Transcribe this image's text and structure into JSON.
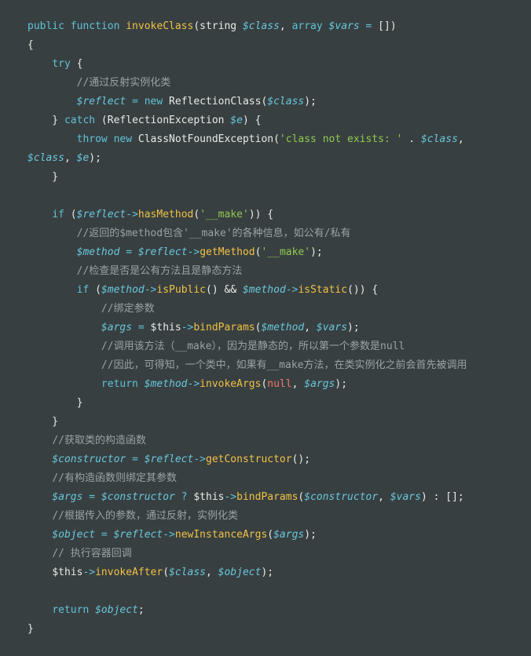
{
  "code": {
    "lines": [
      [
        [
          "kw",
          "public function "
        ],
        [
          "fn",
          "invokeClass"
        ],
        [
          "pl",
          "(string "
        ],
        [
          "var",
          "$class"
        ],
        [
          "pl",
          ", "
        ],
        [
          "kw",
          "array "
        ],
        [
          "var",
          "$vars"
        ],
        [
          "op",
          " = "
        ],
        [
          "pl",
          "[])"
        ]
      ],
      [
        [
          "pl",
          "{"
        ]
      ],
      [
        [
          "pl",
          "    "
        ],
        [
          "kw",
          "try"
        ],
        [
          "pl",
          " {"
        ]
      ],
      [
        [
          "pl",
          "        "
        ],
        [
          "cm",
          "//通过反射实例化类"
        ]
      ],
      [
        [
          "pl",
          "        "
        ],
        [
          "var",
          "$reflect"
        ],
        [
          "op",
          " = "
        ],
        [
          "kw",
          "new "
        ],
        [
          "pl",
          "ReflectionClass("
        ],
        [
          "var",
          "$class"
        ],
        [
          "pl",
          ");"
        ]
      ],
      [
        [
          "pl",
          "    } "
        ],
        [
          "kw",
          "catch"
        ],
        [
          "pl",
          " (ReflectionException "
        ],
        [
          "var",
          "$e"
        ],
        [
          "pl",
          ") {"
        ]
      ],
      [
        [
          "pl",
          "        "
        ],
        [
          "kw",
          "throw new "
        ],
        [
          "pl",
          "ClassNotFoundException("
        ],
        [
          "str",
          "'class not exists: '"
        ],
        [
          "pl",
          " . "
        ],
        [
          "var",
          "$class"
        ],
        [
          "pl",
          ","
        ]
      ],
      [
        [
          "var",
          "$class"
        ],
        [
          "pl",
          ", "
        ],
        [
          "var",
          "$e"
        ],
        [
          "pl",
          ");"
        ]
      ],
      [
        [
          "pl",
          "    }"
        ]
      ],
      [],
      [
        [
          "pl",
          "    "
        ],
        [
          "kw",
          "if"
        ],
        [
          "pl",
          " ("
        ],
        [
          "var",
          "$reflect"
        ],
        [
          "op",
          "->"
        ],
        [
          "fn",
          "hasMethod"
        ],
        [
          "pl",
          "("
        ],
        [
          "str",
          "'__make'"
        ],
        [
          "pl",
          ")) {"
        ]
      ],
      [
        [
          "pl",
          "        "
        ],
        [
          "cm",
          "//返回的$method包含'__make'的各种信息，如公有/私有"
        ]
      ],
      [
        [
          "pl",
          "        "
        ],
        [
          "var",
          "$method"
        ],
        [
          "op",
          " = "
        ],
        [
          "var",
          "$reflect"
        ],
        [
          "op",
          "->"
        ],
        [
          "fn",
          "getMethod"
        ],
        [
          "pl",
          "("
        ],
        [
          "str",
          "'__make'"
        ],
        [
          "pl",
          ");"
        ]
      ],
      [
        [
          "pl",
          "        "
        ],
        [
          "cm",
          "//检查是否是公有方法且是静态方法"
        ]
      ],
      [
        [
          "pl",
          "        "
        ],
        [
          "kw",
          "if"
        ],
        [
          "pl",
          " ("
        ],
        [
          "var",
          "$method"
        ],
        [
          "op",
          "->"
        ],
        [
          "fn",
          "isPublic"
        ],
        [
          "pl",
          "() && "
        ],
        [
          "var",
          "$method"
        ],
        [
          "op",
          "->"
        ],
        [
          "fn",
          "isStatic"
        ],
        [
          "pl",
          "()) {"
        ]
      ],
      [
        [
          "pl",
          "            "
        ],
        [
          "cm",
          "//绑定参数"
        ]
      ],
      [
        [
          "pl",
          "            "
        ],
        [
          "var",
          "$args"
        ],
        [
          "op",
          " = "
        ],
        [
          "this",
          "$this"
        ],
        [
          "op",
          "->"
        ],
        [
          "fn",
          "bindParams"
        ],
        [
          "pl",
          "("
        ],
        [
          "var",
          "$method"
        ],
        [
          "pl",
          ", "
        ],
        [
          "var",
          "$vars"
        ],
        [
          "pl",
          ");"
        ]
      ],
      [
        [
          "pl",
          "            "
        ],
        [
          "cm",
          "//调用该方法（__make），因为是静态的，所以第一个参数是null"
        ]
      ],
      [
        [
          "pl",
          "            "
        ],
        [
          "cm",
          "//因此，可得知，一个类中，如果有__make方法，在类实例化之前会首先被调用"
        ]
      ],
      [
        [
          "pl",
          "            "
        ],
        [
          "kw",
          "return "
        ],
        [
          "var",
          "$method"
        ],
        [
          "op",
          "->"
        ],
        [
          "fn",
          "invokeArgs"
        ],
        [
          "pl",
          "("
        ],
        [
          "null",
          "null"
        ],
        [
          "pl",
          ", "
        ],
        [
          "var",
          "$args"
        ],
        [
          "pl",
          ");"
        ]
      ],
      [
        [
          "pl",
          "        }"
        ]
      ],
      [
        [
          "pl",
          "    }"
        ]
      ],
      [
        [
          "pl",
          "    "
        ],
        [
          "cm",
          "//获取类的构造函数"
        ]
      ],
      [
        [
          "pl",
          "    "
        ],
        [
          "var",
          "$constructor"
        ],
        [
          "op",
          " = "
        ],
        [
          "var",
          "$reflect"
        ],
        [
          "op",
          "->"
        ],
        [
          "fn",
          "getConstructor"
        ],
        [
          "pl",
          "();"
        ]
      ],
      [
        [
          "pl",
          "    "
        ],
        [
          "cm",
          "//有构造函数则绑定其参数"
        ]
      ],
      [
        [
          "pl",
          "    "
        ],
        [
          "var",
          "$args"
        ],
        [
          "op",
          " = "
        ],
        [
          "var",
          "$constructor"
        ],
        [
          "op",
          " ? "
        ],
        [
          "this",
          "$this"
        ],
        [
          "op",
          "->"
        ],
        [
          "fn",
          "bindParams"
        ],
        [
          "pl",
          "("
        ],
        [
          "var",
          "$constructor"
        ],
        [
          "pl",
          ", "
        ],
        [
          "var",
          "$vars"
        ],
        [
          "pl",
          ") : [];"
        ]
      ],
      [
        [
          "pl",
          "    "
        ],
        [
          "cm",
          "//根据传入的参数，通过反射，实例化类"
        ]
      ],
      [
        [
          "pl",
          "    "
        ],
        [
          "var",
          "$object"
        ],
        [
          "op",
          " = "
        ],
        [
          "var",
          "$reflect"
        ],
        [
          "op",
          "->"
        ],
        [
          "fn",
          "newInstanceArgs"
        ],
        [
          "pl",
          "("
        ],
        [
          "var",
          "$args"
        ],
        [
          "pl",
          ");"
        ]
      ],
      [
        [
          "pl",
          "    "
        ],
        [
          "cm",
          "// 执行容器回调"
        ]
      ],
      [
        [
          "pl",
          "    "
        ],
        [
          "this",
          "$this"
        ],
        [
          "op",
          "->"
        ],
        [
          "fn",
          "invokeAfter"
        ],
        [
          "pl",
          "("
        ],
        [
          "var",
          "$class"
        ],
        [
          "pl",
          ", "
        ],
        [
          "var",
          "$object"
        ],
        [
          "pl",
          ");"
        ]
      ],
      [],
      [
        [
          "pl",
          "    "
        ],
        [
          "kw",
          "return "
        ],
        [
          "var",
          "$object"
        ],
        [
          "pl",
          ";"
        ]
      ],
      [
        [
          "pl",
          "}"
        ]
      ]
    ]
  },
  "colors": {
    "background": "#383f41",
    "keyword": "#5fc3d8",
    "function": "#f0c244",
    "variable": "#68c8dc",
    "comment": "#9aa3a4",
    "string": "#8ecb4d",
    "null": "#f07a6a",
    "plain": "#e8ebe6"
  }
}
